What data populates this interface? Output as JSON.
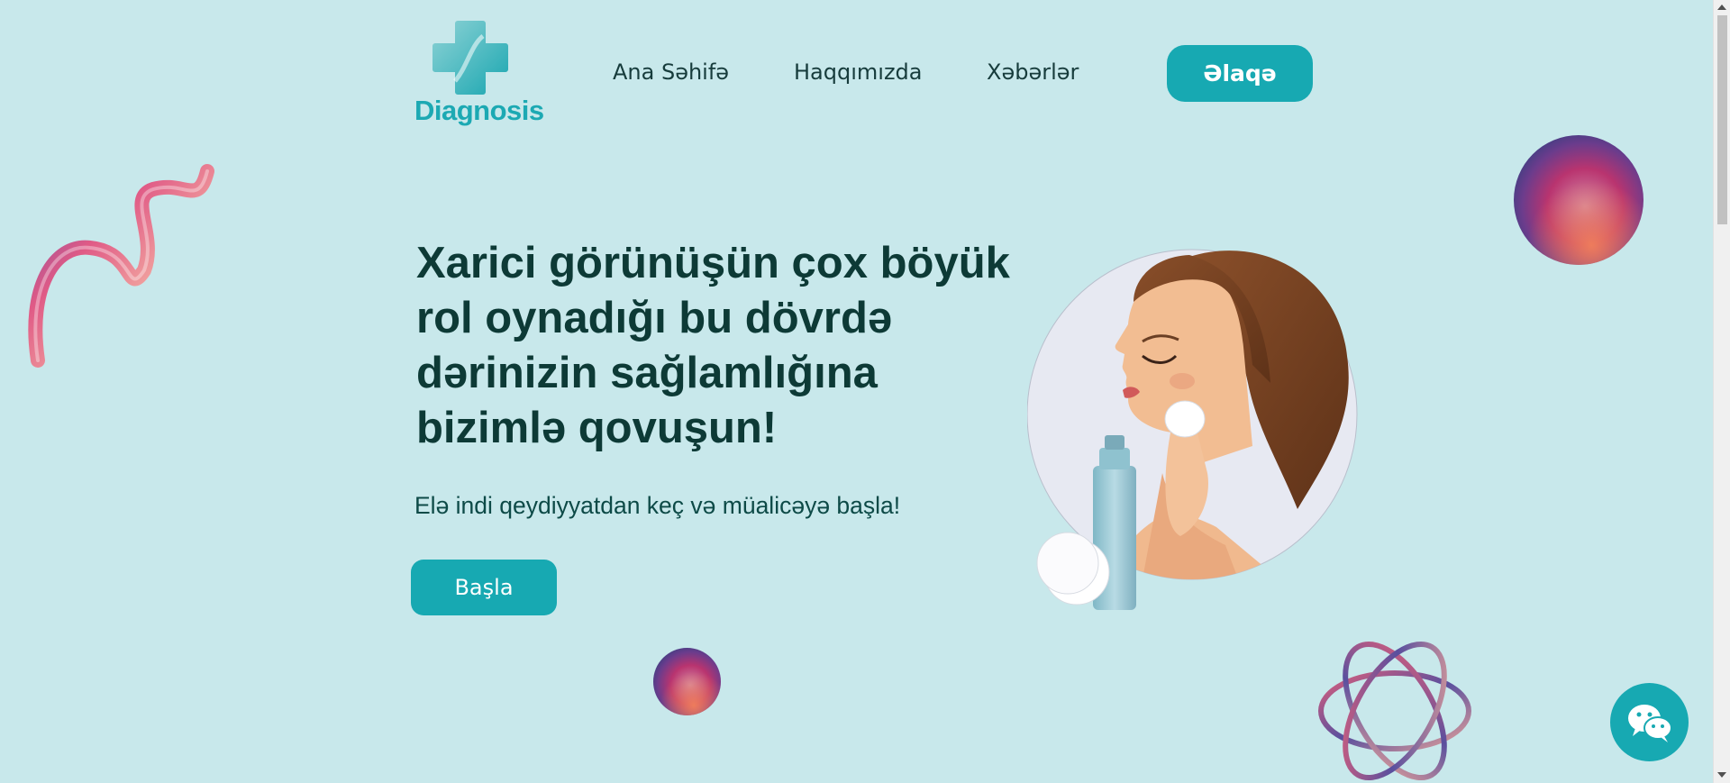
{
  "brand": {
    "name": "Diagnosis",
    "icon": "medical-cross-icon"
  },
  "nav": {
    "items": [
      {
        "label": "Ana Səhifə"
      },
      {
        "label": "Haqqımızda"
      },
      {
        "label": "Xəbərlər"
      }
    ],
    "contact_label": "Əlaqə"
  },
  "hero": {
    "title_lines": [
      "Xarici görünüşün çox böyük",
      "rol oynadığı bu dövrdə",
      "dərinizin sağlamlığına",
      "bizimlə qovuşun!"
    ],
    "subtitle": "Elə indi qeydiyyatdan keç və müalicəyə başla!",
    "cta_label": "Başla",
    "illustration": "woman-skincare-illustration"
  },
  "chat": {
    "icon": "wechat-bubbles-icon"
  },
  "colors": {
    "background": "#c8e8eb",
    "accent": "#17a9b2",
    "heading": "#0d3a36"
  }
}
